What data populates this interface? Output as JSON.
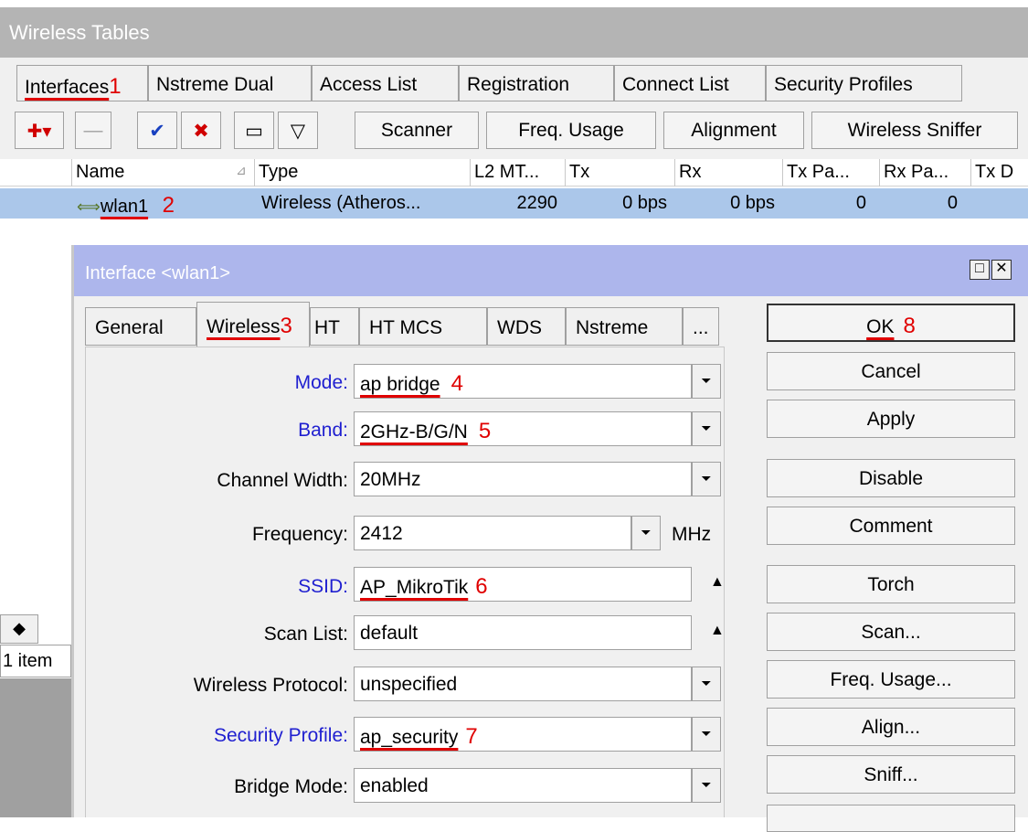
{
  "wireless_tables": {
    "title": "Wireless Tables",
    "tabs": [
      "Interfaces",
      "Nstreme Dual",
      "Access List",
      "Registration",
      "Connect List",
      "Security Profiles"
    ],
    "toolbar": {
      "add_glyph": "✚▾",
      "remove_glyph": "—",
      "enable_glyph": "✔",
      "disable_glyph": "✖",
      "comment_glyph": "▭",
      "filter_glyph": "▽",
      "buttons": [
        "Scanner",
        "Freq. Usage",
        "Alignment",
        "Wireless Sniffer"
      ]
    },
    "columns": [
      "Name",
      "Type",
      "L2 MT...",
      "Tx",
      "Rx",
      "Tx Pa...",
      "Rx Pa...",
      "Tx D"
    ],
    "sort_glyph": "⊿",
    "row": {
      "icon_glyph": "⟺",
      "name": "wlan1",
      "type": "Wireless (Atheros...",
      "l2mtu": "2290",
      "tx": "0 bps",
      "rx": "0 bps",
      "tx_packets": "0",
      "rx_packets": "0"
    },
    "scroll_left_glyph": "◆",
    "status": "1 item"
  },
  "dialog": {
    "title": "Interface <wlan1>",
    "maximize_glyph": "□",
    "close_glyph": "✕",
    "tabs": [
      "General",
      "Wireless",
      "HT",
      "HT MCS",
      "WDS",
      "Nstreme",
      "..."
    ],
    "fields": {
      "mode": {
        "label": "Mode:",
        "value": "ap bridge"
      },
      "band": {
        "label": "Band:",
        "value": "2GHz-B/G/N"
      },
      "channel_width": {
        "label": "Channel Width:",
        "value": "20MHz"
      },
      "frequency": {
        "label": "Frequency:",
        "value": "2412",
        "unit": "MHz"
      },
      "ssid": {
        "label": "SSID:",
        "value": "AP_MikroTik"
      },
      "scan_list": {
        "label": "Scan List:",
        "value": "default"
      },
      "wireless_protocol": {
        "label": "Wireless Protocol:",
        "value": "unspecified"
      },
      "security_profile": {
        "label": "Security Profile:",
        "value": "ap_security"
      },
      "bridge_mode": {
        "label": "Bridge Mode:",
        "value": "enabled"
      }
    },
    "drop_glyph": "⏷",
    "up_glyph": "▲",
    "buttons": [
      "OK",
      "Cancel",
      "Apply",
      "Disable",
      "Comment",
      "Torch",
      "Scan...",
      "Freq. Usage...",
      "Align...",
      "Sniff..."
    ]
  },
  "annotations": [
    "1",
    "2",
    "3",
    "4",
    "5",
    "6",
    "7",
    "8"
  ],
  "colors": {
    "title_bar": "#b4b4b4",
    "dialog_title": "#adb6ec",
    "selected_row": "#abc7ea",
    "field_label_blue": "#2020d0",
    "annotation_red": "#e00000"
  }
}
